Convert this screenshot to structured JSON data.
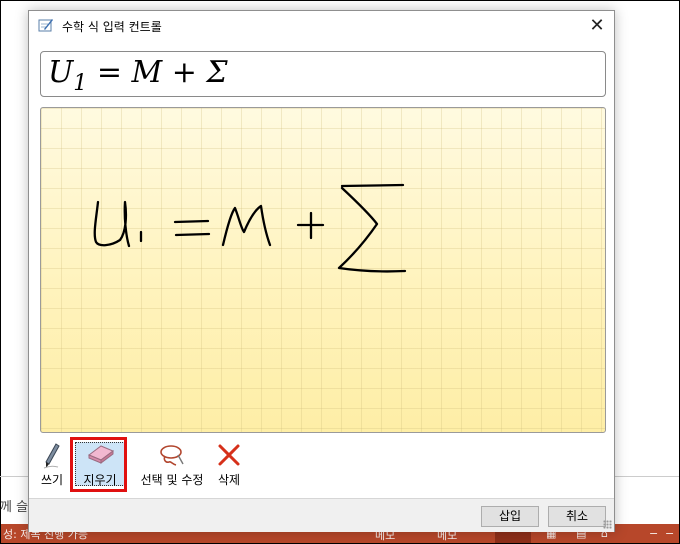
{
  "window": {
    "title": "수학 식 입력 컨트롤",
    "close_symbol": "✕"
  },
  "preview": {
    "lhs": "U",
    "subscript": "1",
    "rhs": " = M + Σ"
  },
  "tools": {
    "write": "쓰기",
    "erase": "지우기",
    "select_correct": "선택 및 수정",
    "delete": "삭제"
  },
  "buttons": {
    "insert": "삽입",
    "cancel": "취소"
  },
  "background": {
    "left_text": "께 슬",
    "status_text": "성: 제목 진행 가능",
    "status_icon_a": "메모",
    "status_icon_b": "메모"
  },
  "colors": {
    "pad": "#fff5c2",
    "highlight": "#e01010",
    "selected_tool": "#cde4f7",
    "status_bar": "#b7472a"
  }
}
